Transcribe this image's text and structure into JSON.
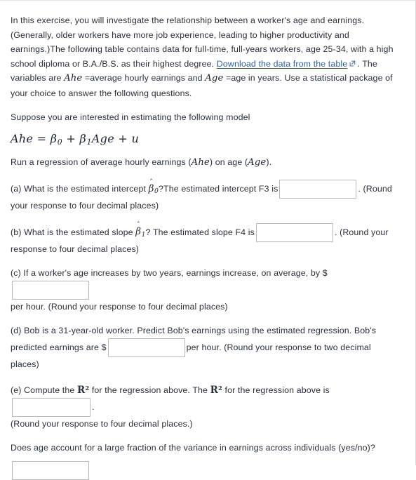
{
  "intro": {
    "text_part1": "In this exercise, you will investigate the relationship between a worker's age and earnings. (Generally, older workers have more job experience, leading to higher productivity and earnings.)The following table contains data for full-time, full-years workers, age 25-34, with a high school diploma or B.A./B.S. as their highest degree. ",
    "link_label": "Download the data from the table",
    "link_icon": "external-link-icon",
    "text_part2": ". The variables are ",
    "var_ahe": "Ahe",
    "text_part3": " =average hourly earnings and ",
    "var_age": "Age",
    "text_part4": " =age in years. Use a statistical package of your choice to answer the following questions."
  },
  "model": {
    "lead_in": "Suppose you are interested in estimating the following model",
    "equation": {
      "lhs": "Ahe",
      "eq": " = ",
      "beta0": "β",
      "beta0_sub": "0",
      "plus1": " + ",
      "beta1": "β",
      "beta1_sub": "1",
      "age": "Age",
      "plus2": " + ",
      "u": "u"
    },
    "instruction_a": "Run a regression of average hourly earnings (",
    "instruction_ahe": "Ahe",
    "instruction_b": ") on age (",
    "instruction_age": "Age",
    "instruction_c": ")."
  },
  "questions": {
    "a": {
      "text_before_symbol": "(a) What is the estimated intercept ",
      "symbol_base": "β",
      "symbol_hat": "ˆ",
      "symbol_sub": "0",
      "text_after_symbol": "?The estimated intercept F3 is",
      "input_value": "",
      "input_placeholder": "",
      "text_after_input": ". (Round",
      "text_second_line": "your response to four decimal places)"
    },
    "b": {
      "text_before_symbol": "(b) What is the estimated slope ",
      "symbol_base": "β",
      "symbol_hat": "ˆ",
      "symbol_sub": "1",
      "text_after_symbol": "? The estimated slope F4 is",
      "input_value": "",
      "input_placeholder": "",
      "text_after_input": ". (Round your",
      "text_second_line": "response to four decimal places)"
    },
    "c": {
      "text_before_input": "(c) If a worker's age increases by two years, earnings increase, on average, by $",
      "input_value": "",
      "input_placeholder": "",
      "text_second_line": "per hour. (Round your response to four decimal places)"
    },
    "d": {
      "text_line1": "(d) Bob is a 31-year-old worker. Predict Bob's earnings using the estimated regression. Bob's",
      "text_before_input": "predicted earnings are $",
      "input_value": "",
      "input_placeholder": "",
      "text_after_input": "per hour. (Round your response to two decimal places)"
    },
    "e": {
      "text_1": "(e) Compute the ",
      "rsq_base": "R",
      "rsq_exp": "2",
      "text_2": " for the regression above. The ",
      "text_3": " for the regression above is",
      "input_value": "",
      "input_placeholder": "",
      "text_after_input": ".",
      "text_second_line": "(Round your response to four decimal places.)"
    },
    "final": {
      "prompt": "Does age account for a large fraction of the variance in earnings across individuals (yes/no)?",
      "input_value": "",
      "input_placeholder": ""
    }
  },
  "colors": {
    "text": "#28303c",
    "link": "#2f5fa8",
    "input_border": "#b9b9b9",
    "page_background": "#ffffff"
  }
}
